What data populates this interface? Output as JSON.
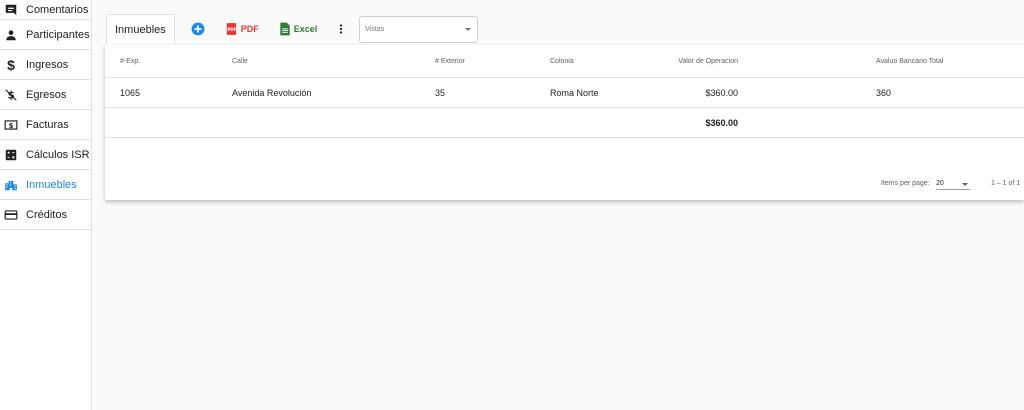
{
  "sidebar": {
    "items": [
      {
        "label": "Comentarios",
        "icon": "comment-icon"
      },
      {
        "label": "Participantes",
        "icon": "person-icon"
      },
      {
        "label": "Ingresos",
        "icon": "dollar-icon"
      },
      {
        "label": "Egresos",
        "icon": "money-off-icon"
      },
      {
        "label": "Facturas",
        "icon": "invoice-icon"
      },
      {
        "label": "Cálculos ISR",
        "icon": "calculator-icon"
      },
      {
        "label": "Inmuebles",
        "icon": "building-icon",
        "active": true
      },
      {
        "label": "Créditos",
        "icon": "credit-card-icon"
      }
    ]
  },
  "toolbar": {
    "tab_label": "Inmuebles",
    "pdf_label": "PDF",
    "excel_label": "Excel",
    "vistas_placeholder": "Vistas"
  },
  "table": {
    "columns": [
      "#-Exp.",
      "Calle",
      "# Exterior",
      "Colonia",
      "Valor de Operacion",
      "Avaluo Bancario Total"
    ],
    "rows": [
      [
        "1065",
        "Avenida Revolución",
        "35",
        "Roma Norte",
        "$360.00",
        "360"
      ]
    ],
    "total_valor": "$360.00"
  },
  "paginator": {
    "items_per_page_label": "Items per page:",
    "page_size": "20",
    "range": "1 – 1 of 1"
  },
  "colors": {
    "accent": "#1e88e5",
    "pdf": "#e53935",
    "excel": "#2e7d32"
  }
}
